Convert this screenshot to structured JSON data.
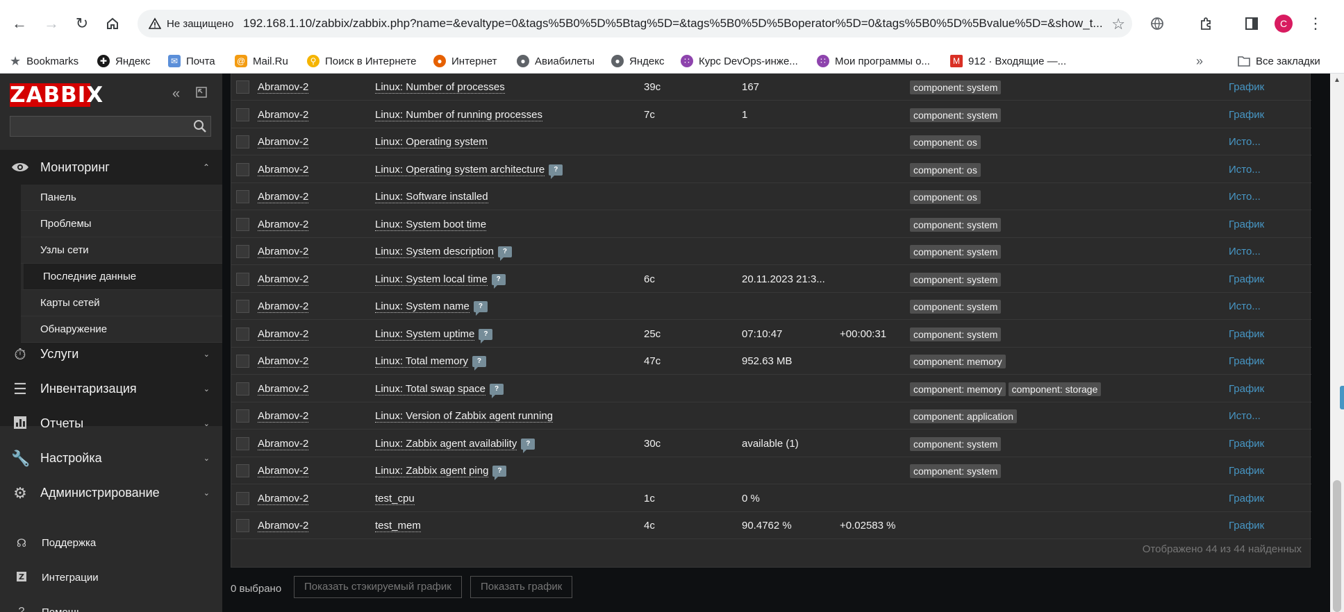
{
  "browser": {
    "security_label": "Не защищено",
    "url": "192.168.1.10/zabbix/zabbix.php?name=&evaltype=0&tags%5B0%5D%5Btag%5D=&tags%5B0%5D%5Boperator%5D=0&tags%5B0%5D%5Bvalue%5D=&show_t...",
    "profile_initial": "C",
    "bookmarks": [
      {
        "label": "Bookmarks",
        "icon": "star-icon"
      },
      {
        "label": "Яндекс",
        "icon": "yandex-icon"
      },
      {
        "label": "Почта",
        "icon": "mail-icon"
      },
      {
        "label": "Mail.Ru",
        "icon": "mailru-icon"
      },
      {
        "label": "Поиск в Интернете",
        "icon": "search-icon"
      },
      {
        "label": "Интернет",
        "icon": "firefox-icon"
      },
      {
        "label": "Авиабилеты",
        "icon": "globe-icon"
      },
      {
        "label": "Яндекс",
        "icon": "globe-icon"
      },
      {
        "label": "Курс DevOps-инже...",
        "icon": "dots-icon"
      },
      {
        "label": "Мои программы о...",
        "icon": "dots-icon"
      },
      {
        "label": "912 · Входящие —...",
        "icon": "gmail-icon"
      }
    ],
    "all_bookmarks": "Все закладки"
  },
  "sidebar": {
    "logo": "ZABBIX",
    "monitoring": {
      "label": "Мониторинг",
      "items": [
        "Панель",
        "Проблемы",
        "Узлы сети",
        "Последние данные",
        "Карты сетей",
        "Обнаружение"
      ],
      "selected": "Последние данные"
    },
    "sections": [
      {
        "label": "Услуги",
        "icon": "services-icon"
      },
      {
        "label": "Инвентаризация",
        "icon": "inventory-icon"
      },
      {
        "label": "Отчеты",
        "icon": "reports-icon"
      },
      {
        "label": "Настройка",
        "icon": "wrench-icon"
      },
      {
        "label": "Администрирование",
        "icon": "gear-icon"
      }
    ],
    "footer": [
      {
        "label": "Поддержка",
        "icon": "headset-icon"
      },
      {
        "label": "Интеграции",
        "icon": "integrations-icon"
      },
      {
        "label": "Помощь",
        "icon": "help-icon"
      }
    ]
  },
  "table": {
    "rows": [
      {
        "host": "Abramov-2",
        "name": "Linux: Number of processes",
        "help": false,
        "interval": "39с",
        "last_value": "167",
        "change": "",
        "tags": [
          "component: system"
        ],
        "action": "График"
      },
      {
        "host": "Abramov-2",
        "name": "Linux: Number of running processes",
        "help": false,
        "interval": "7с",
        "last_value": "1",
        "change": "",
        "tags": [
          "component: system"
        ],
        "action": "График"
      },
      {
        "host": "Abramov-2",
        "name": "Linux: Operating system",
        "help": false,
        "interval": "",
        "last_value": "",
        "change": "",
        "tags": [
          "component: os"
        ],
        "action": "Исто..."
      },
      {
        "host": "Abramov-2",
        "name": "Linux: Operating system architecture",
        "help": true,
        "interval": "",
        "last_value": "",
        "change": "",
        "tags": [
          "component: os"
        ],
        "action": "Исто..."
      },
      {
        "host": "Abramov-2",
        "name": "Linux: Software installed",
        "help": false,
        "interval": "",
        "last_value": "",
        "change": "",
        "tags": [
          "component: os"
        ],
        "action": "Исто..."
      },
      {
        "host": "Abramov-2",
        "name": "Linux: System boot time",
        "help": false,
        "interval": "",
        "last_value": "",
        "change": "",
        "tags": [
          "component: system"
        ],
        "action": "График"
      },
      {
        "host": "Abramov-2",
        "name": "Linux: System description",
        "help": true,
        "interval": "",
        "last_value": "",
        "change": "",
        "tags": [
          "component: system"
        ],
        "action": "Исто..."
      },
      {
        "host": "Abramov-2",
        "name": "Linux: System local time",
        "help": true,
        "interval": "6с",
        "last_value": "20.11.2023 21:3...",
        "change": "",
        "tags": [
          "component: system"
        ],
        "action": "График"
      },
      {
        "host": "Abramov-2",
        "name": "Linux: System name",
        "help": true,
        "interval": "",
        "last_value": "",
        "change": "",
        "tags": [
          "component: system"
        ],
        "action": "Исто..."
      },
      {
        "host": "Abramov-2",
        "name": "Linux: System uptime",
        "help": true,
        "interval": "25с",
        "last_value": "07:10:47",
        "change": "+00:00:31",
        "tags": [
          "component: system"
        ],
        "action": "График"
      },
      {
        "host": "Abramov-2",
        "name": "Linux: Total memory",
        "help": true,
        "interval": "47с",
        "last_value": "952.63 MB",
        "change": "",
        "tags": [
          "component: memory"
        ],
        "action": "График"
      },
      {
        "host": "Abramov-2",
        "name": "Linux: Total swap space",
        "help": true,
        "interval": "",
        "last_value": "",
        "change": "",
        "tags": [
          "component: memory",
          "component: storage"
        ],
        "action": "График"
      },
      {
        "host": "Abramov-2",
        "name": "Linux: Version of Zabbix agent running",
        "help": false,
        "interval": "",
        "last_value": "",
        "change": "",
        "tags": [
          "component: application"
        ],
        "action": "Исто..."
      },
      {
        "host": "Abramov-2",
        "name": "Linux: Zabbix agent availability",
        "help": true,
        "interval": "30с",
        "last_value": "available (1)",
        "change": "",
        "tags": [
          "component: system"
        ],
        "action": "График"
      },
      {
        "host": "Abramov-2",
        "name": "Linux: Zabbix agent ping",
        "help": true,
        "interval": "",
        "last_value": "",
        "change": "",
        "tags": [
          "component: system"
        ],
        "action": "График"
      },
      {
        "host": "Abramov-2",
        "name": "test_cpu",
        "help": false,
        "interval": "1с",
        "last_value": "0 %",
        "change": "",
        "tags": [],
        "action": "График"
      },
      {
        "host": "Abramov-2",
        "name": "test_mem",
        "help": false,
        "interval": "4с",
        "last_value": "90.4762 %",
        "change": "+0.02583 %",
        "tags": [],
        "action": "График"
      }
    ],
    "summary": "Отображено 44 из 44 найденных"
  },
  "footer_bar": {
    "selected_count": "0 выбрано",
    "stacked_graph_button": "Показать стэкируемый график",
    "graph_button": "Показать график"
  }
}
